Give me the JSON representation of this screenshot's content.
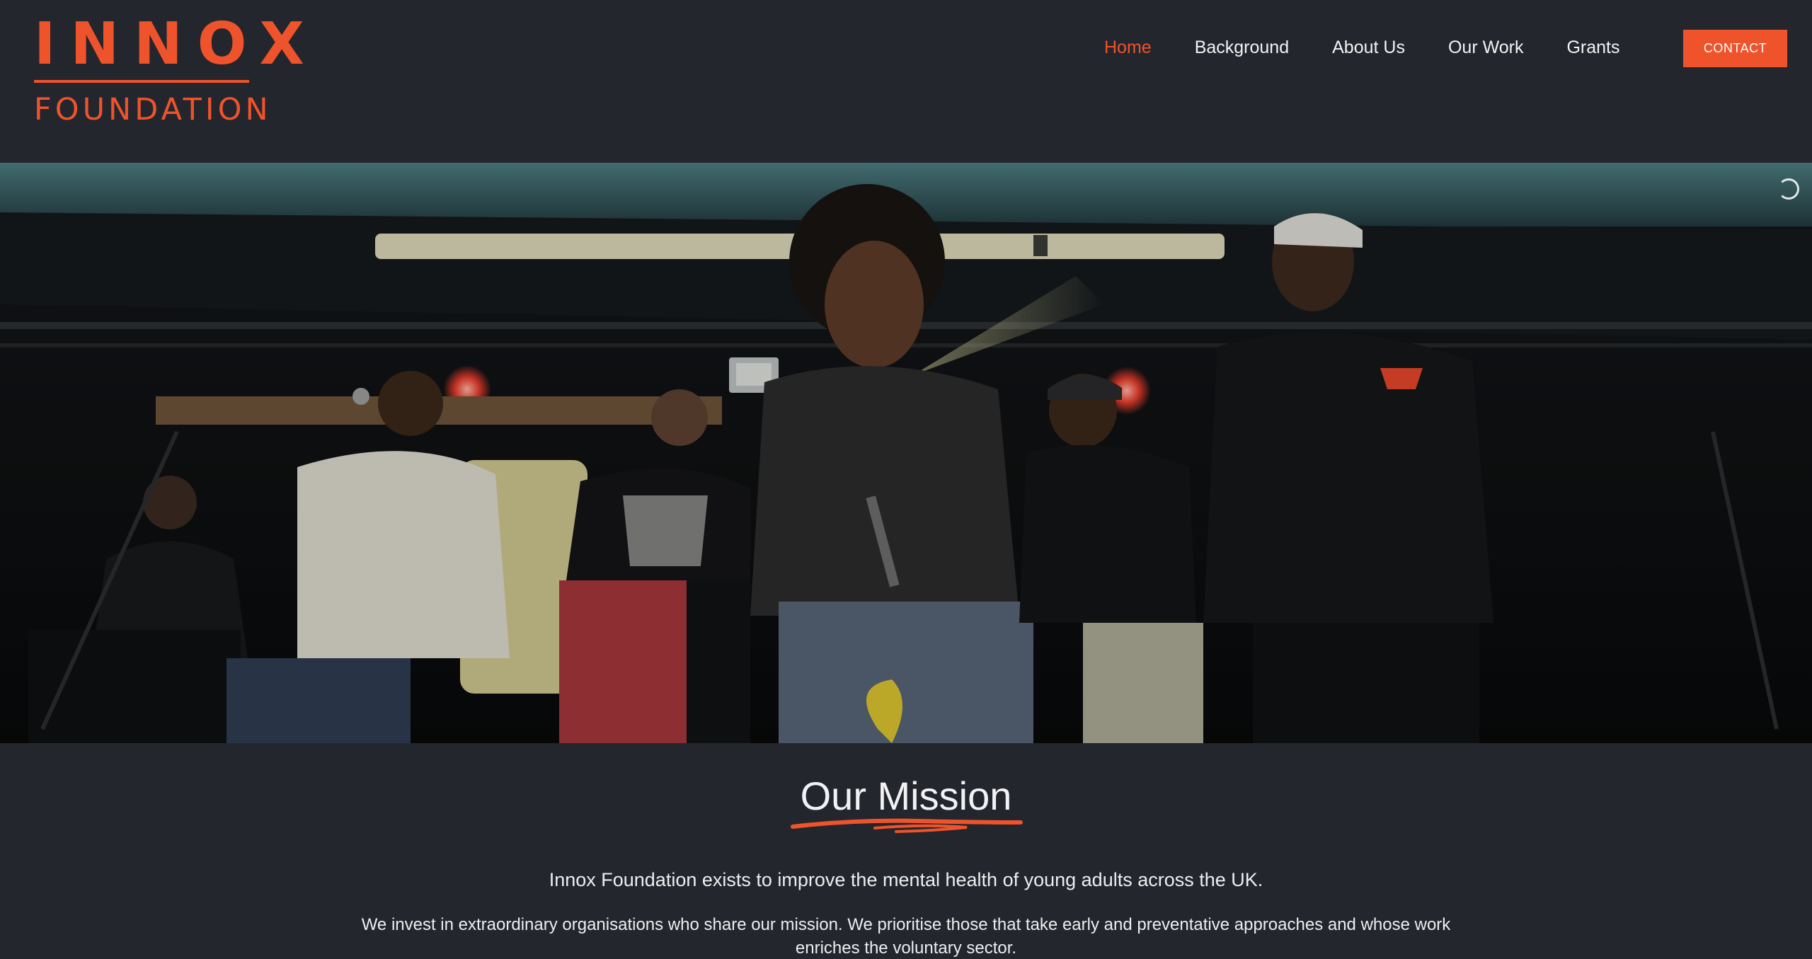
{
  "brand": {
    "name_top": "INNOX",
    "name_bottom": "FOUNDATION",
    "accent_color": "#ef532b"
  },
  "nav": {
    "items": [
      {
        "label": "Home",
        "active": true
      },
      {
        "label": "Background",
        "active": false
      },
      {
        "label": "About Us",
        "active": false
      },
      {
        "label": "Our Work",
        "active": false
      },
      {
        "label": "Grants",
        "active": false
      }
    ],
    "contact_label": "CONTACT"
  },
  "hero": {
    "image_subject": "photo of young performers singing with microphones on a dimly lit stage",
    "loading_indicator": "spinner-icon"
  },
  "mission": {
    "title": "Our Mission",
    "lead": "Innox Foundation exists to improve the mental health of young adults across the UK.",
    "body": "We invest in extraordinary organisations who share our mission. We prioritise those that take early and preventative approaches and whose work enriches the voluntary sector."
  },
  "colors": {
    "background": "#24262d",
    "accent": "#ef532b",
    "text": "#f2f2f4"
  }
}
